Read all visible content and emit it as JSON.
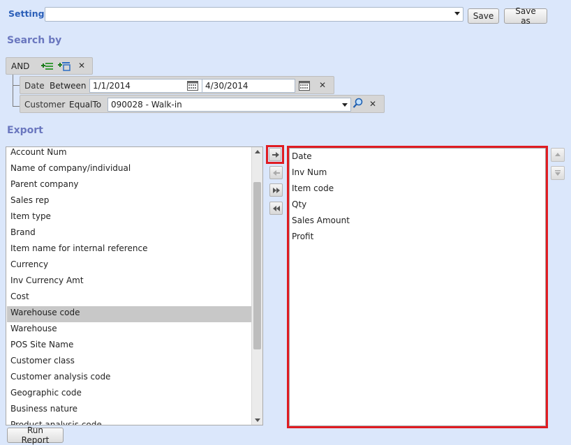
{
  "setting": {
    "label": "Setting:",
    "value": "",
    "save_label": "Save",
    "save_as_label": "Save as"
  },
  "search": {
    "heading": "Search by",
    "group_operator": "AND",
    "criteria": [
      {
        "field": "Date",
        "operator": "Between",
        "from": "1/1/2014",
        "to": "4/30/2014"
      },
      {
        "field": "Customer",
        "operator": "EqualTo",
        "value": "090028 - Walk-in"
      }
    ]
  },
  "export": {
    "heading": "Export",
    "available_fields": [
      "Account Num",
      "Name of company/individual",
      "Parent company",
      "Sales rep",
      "Item type",
      "Brand",
      "Item name for internal reference",
      "Currency",
      "Inv Currency Amt",
      "Cost",
      "Warehouse code",
      "Warehouse",
      "POS Site Name",
      "Customer class",
      "Customer analysis code",
      "Geographic code",
      "Business nature",
      "Product analysis code"
    ],
    "selected_available_index": 10,
    "selected_fields": [
      "Date",
      "Inv Num",
      "Item code",
      "Qty",
      "Sales Amount",
      "Profit"
    ]
  },
  "run_report_label": "Run Report",
  "colors": {
    "background": "#dbe7fb",
    "heading": "#6a77bf",
    "label": "#2b5fb8",
    "highlight": "#e01c22"
  },
  "icons": {
    "add_condition": "add-condition-icon",
    "add_group": "add-group-icon",
    "remove": "close-icon",
    "calendar": "calendar-icon",
    "search": "magnifier-icon",
    "move_right": "arrow-right-icon",
    "move_left": "arrow-left-icon",
    "move_all_right": "double-arrow-right-icon",
    "move_all_left": "double-arrow-left-icon",
    "move_up": "arrow-up-icon",
    "move_down": "arrow-down-icon"
  }
}
